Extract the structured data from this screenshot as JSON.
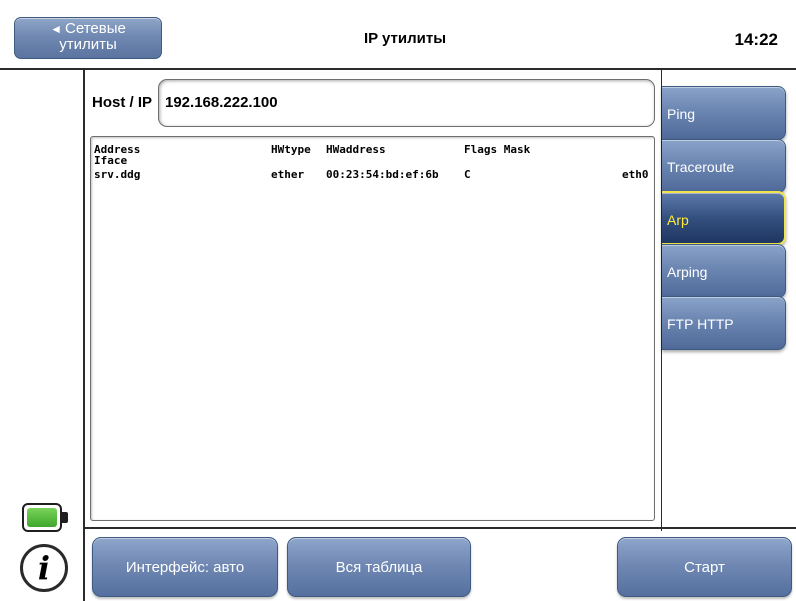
{
  "header": {
    "back_line1": "Сетевые",
    "back_line2": "утилиты",
    "back_arrow": "◄",
    "title": "IP утилиты",
    "clock": "14:22"
  },
  "host": {
    "label": "Host / IP",
    "value": "192.168.222.100"
  },
  "arp_table": {
    "headers": [
      "Address",
      "HWtype",
      "HWaddress",
      "Flags Mask",
      "Iface"
    ],
    "rows": [
      {
        "address": "srv.ddg",
        "hwtype": "ether",
        "hwaddress": "00:23:54:bd:ef:6b",
        "flags": "C",
        "iface": "eth0"
      }
    ]
  },
  "tabs": [
    {
      "label": "Ping",
      "active": false
    },
    {
      "label": "Traceroute",
      "active": false
    },
    {
      "label": "Arp",
      "active": true
    },
    {
      "label": "Arping",
      "active": false
    },
    {
      "label": "FTP HTTP",
      "active": false
    }
  ],
  "bottom_buttons": {
    "interface": "Интерфейс: авто",
    "table": "Вся таблица",
    "start": "Старт"
  },
  "status": {
    "battery_level": 1.0,
    "battery_color": "#4cbb3a",
    "info_icon_glyph": "i"
  },
  "colors": {
    "button_blue": "#7189b2",
    "active_tab": "#1e3561",
    "active_tab_text": "#ffea3a"
  }
}
